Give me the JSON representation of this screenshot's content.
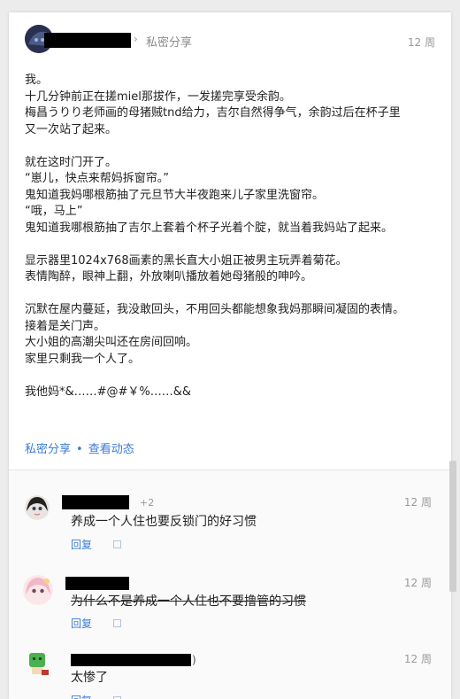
{
  "post": {
    "share_label": "私密分享",
    "time": "12 周",
    "body_lines": [
      "我。",
      "十几分钟前正在搓miel那拔作，一发搓完享受余韵。",
      "梅昌うりり老师画的母猪贼tnd给力，吉尔自然得争气，余韵过后在杯子里",
      "又一次站了起来。",
      "",
      "就在这时门开了。",
      "“崽儿，快点来帮妈拆窗帘。”",
      "鬼知道我妈哪根筋抽了元旦节大半夜跑来儿子家里洗窗帘。",
      "“哦，马上”",
      "鬼知道我哪根筋抽了吉尔上套着个杯子光着个腚，就当着我妈站了起来。",
      "",
      "显示器里1024x768画素的黑长直大小姐正被男主玩弄着菊花。",
      "表情陶醉，眼神上翻，外放喇叭播放着她母猪般的呻吟。",
      "",
      "沉默在屋内蔓延，我没敢回头，不用回头都能想象我妈那瞬间凝固的表情。",
      "接着是关门声。",
      "大小姐的高潮尖叫还在房间回响。",
      "家里只剩我一个人了。",
      "",
      "我他妈*&……#@#￥%……&&"
    ],
    "footer_share": "私密分享",
    "footer_dot": "•",
    "footer_activity": "查看动态"
  },
  "comments": [
    {
      "plus": "+2",
      "time": "12 周",
      "text": "养成一个人住也要反锁门的好习惯",
      "strike": false,
      "reply": "回复"
    },
    {
      "plus": "",
      "time": "12 周",
      "text": "为什么不是养成一个人住也不要撸管的习惯",
      "strike": true,
      "reply": "回复"
    },
    {
      "plus": ")",
      "time": "12 周",
      "text": "太惨了",
      "strike": false,
      "reply": "回复"
    }
  ],
  "colors": {
    "link": "#3b7bd6",
    "muted": "#999999",
    "redaction": "#000000"
  }
}
